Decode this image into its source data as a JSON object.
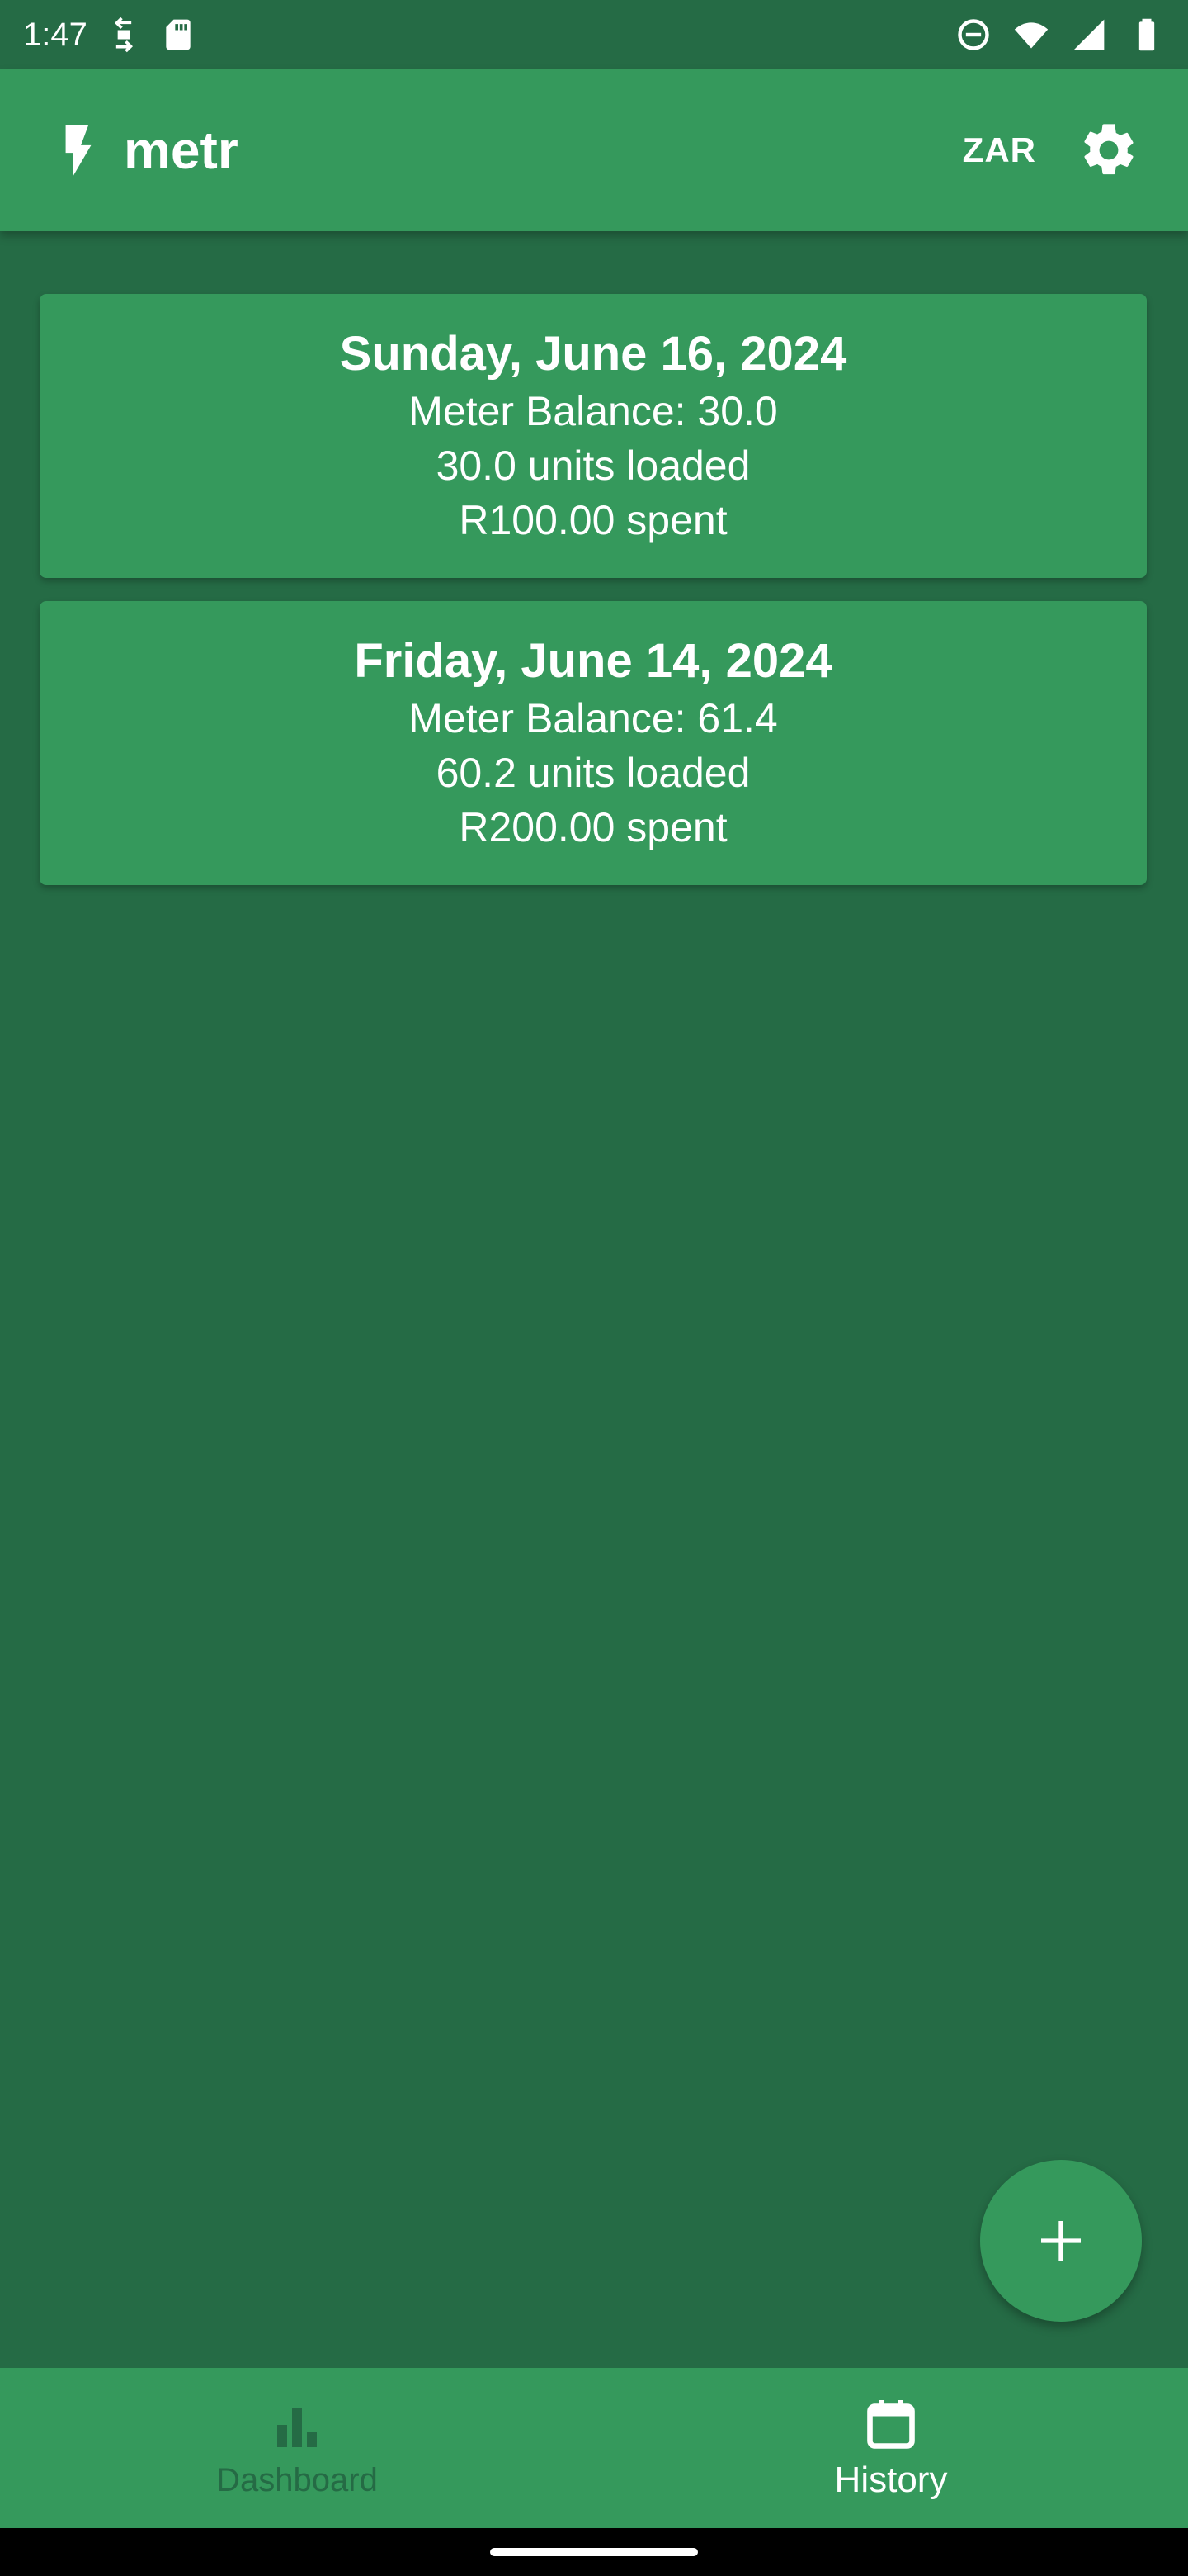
{
  "status_bar": {
    "time": "1:47",
    "icons": [
      "sync-icon",
      "sd-card-icon",
      "do-not-disturb-icon",
      "wifi-icon",
      "signal-icon",
      "battery-icon"
    ]
  },
  "app_bar": {
    "title": "metr",
    "logo_icon": "bolt-icon",
    "currency": "ZAR",
    "settings_icon": "gear-icon"
  },
  "history": [
    {
      "date": "Sunday, June 16, 2024",
      "balance": "Meter Balance: 30.0",
      "units": "30.0 units loaded",
      "spent": "R100.00 spent"
    },
    {
      "date": "Friday, June 14, 2024",
      "balance": "Meter Balance: 61.4",
      "units": "60.2 units loaded",
      "spent": "R200.00 spent"
    }
  ],
  "fab": {
    "icon": "plus-icon"
  },
  "bottom_nav": {
    "items": [
      {
        "label": "Dashboard",
        "icon": "bar-chart-icon",
        "active": false
      },
      {
        "label": "History",
        "icon": "calendar-icon",
        "active": true
      }
    ]
  },
  "colors": {
    "background": "#256b45",
    "surface": "#35995c",
    "text": "#ffffff",
    "inactive": "#256b45"
  }
}
